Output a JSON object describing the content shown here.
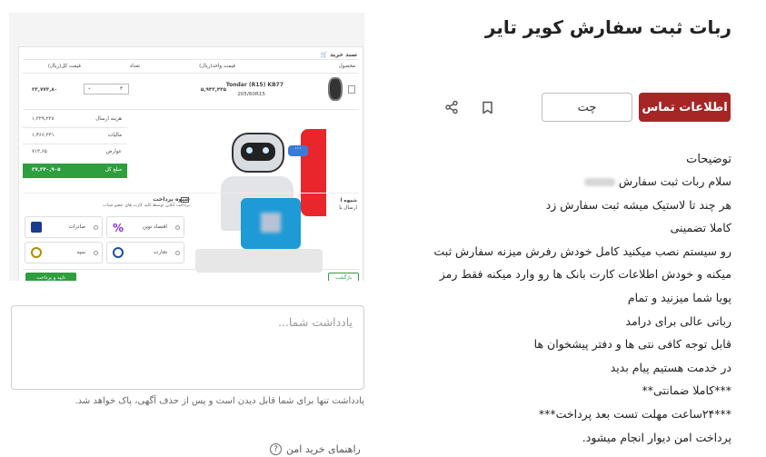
{
  "ad": {
    "title": "ربات ثبت سفارش کویر تایر",
    "contact_button": "اطلاعات تماس",
    "chat_button": "چت",
    "icons": {
      "bookmark": "bookmark-icon",
      "share": "share-icon"
    }
  },
  "description": {
    "heading": "توضیحات",
    "lines": [
      "سلام ربات ثبت سفارش",
      "هر چند تا لاستیک میشه ثبت سفارش زد",
      "کاملا تضمینی",
      "رو سیستم نصب میکنید کامل خودش رفرش میزنه سفارش ثبت",
      "میکنه و خودش اطلاعات کارت بانک ها رو وارد میکنه فقط رمز",
      "پویا شما میزنید و تمام",
      "رباتی عالی برای درامد",
      "قابل توجه کافی نتی ها و دفتر پیشخوان ها",
      "در خدمت هستیم پیام بدید",
      "***کاملا ضمانتی**",
      "***۲۴ساعت مهلت تست بعد پرداخت***",
      "پرداخت امن دیوار انجام میشود."
    ]
  },
  "note": {
    "placeholder": "یادداشت شما...",
    "help": "یادداشت تنها برای شما قابل دیدن است و پس از حذف آگهی، پاک خواهد شد."
  },
  "guide": {
    "label": "راهنمای خرید امن"
  },
  "screenshot": {
    "cart_title": "سبد خرید",
    "headers": {
      "product": "محصول",
      "unit_price": "قیمت واحد(ریال)",
      "qty": "تعداد",
      "total": "قیمت کل(ریال)"
    },
    "product_name": "Tondar (R15) KB77",
    "product_size": "205/60R15",
    "unit_price": "۵,۹۴۳,۴۴۵",
    "qty": "۴",
    "total": "۲۳,۷۷۳,۸۰",
    "summary": [
      {
        "label": "هزینه ارسال",
        "value": "۱,۳۲۹,۲۲۸"
      },
      {
        "label": "مالیات",
        "value": "۱,۴۶۶,۳۳۱"
      },
      {
        "label": "عوارض",
        "value": "۷۱۳,۶۵"
      },
      {
        "label": "مبلغ کل",
        "value": "۲۷,۲۴۰,۹۰۵"
      }
    ],
    "payment_title": "شیوه پرداخت",
    "payment_sub": "پرداخت آنلاین توسط کلیه کارت های عضو شتاب",
    "banks": [
      "اقتصاد نوین",
      "صادرات",
      "تجارت",
      "سپه"
    ],
    "back_button": "بازگشت",
    "confirm_button": "تایید و پرداخت",
    "send_label": "شیوه ا",
    "send_sub": "ارسال با"
  }
}
